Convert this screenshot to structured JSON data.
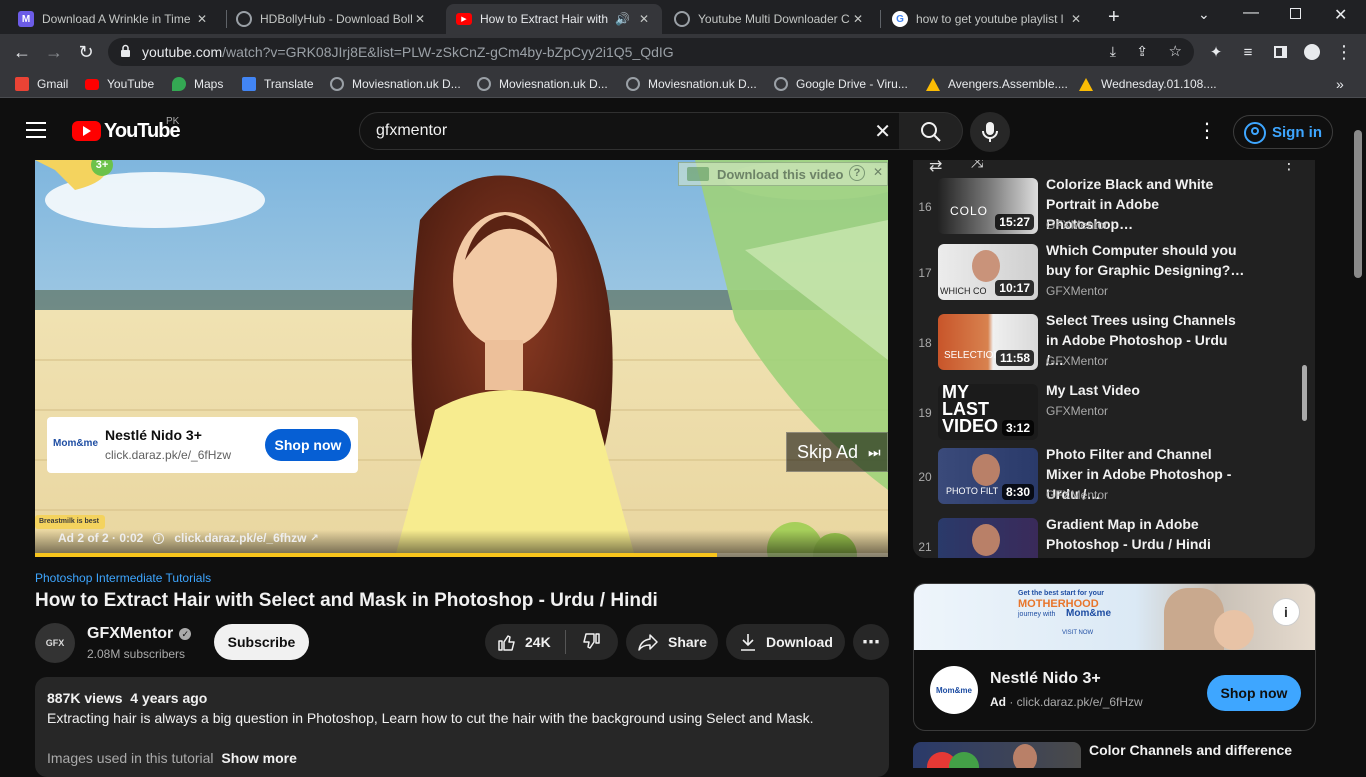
{
  "browser": {
    "tabs": [
      {
        "title": "Download A Wrinkle in Time",
        "icon": "m-favicon-icon",
        "color": "#6c5ce7"
      },
      {
        "title": "HDBollyHub - Download Boll",
        "icon": "globe-favicon-icon",
        "color": "#9aa0a6"
      },
      {
        "title": "How to Extract Hair with",
        "icon": "youtube-favicon-icon",
        "color": "#ff0000",
        "active": true
      },
      {
        "title": "Youtube Multi Downloader C",
        "icon": "globe-favicon-icon",
        "color": "#9aa0a6"
      },
      {
        "title": "how to get youtube playlist l",
        "icon": "google-favicon-icon",
        "color": "#4285f4"
      }
    ],
    "url_host": "youtube.com",
    "url_path": "/watch?v=GRK08JIrj8E&list=PLW-zSkCnZ-gCm4by-bZpCyy2i1Q5_QdIG",
    "bookmarks": [
      {
        "label": "Gmail",
        "color": "#ea4335"
      },
      {
        "label": "YouTube",
        "color": "#ff0000"
      },
      {
        "label": "Maps",
        "color": "#34a853"
      },
      {
        "label": "Translate",
        "color": "#4285f4"
      },
      {
        "label": "Moviesnation.uk D...",
        "color": "#9aa0a6"
      },
      {
        "label": "Moviesnation.uk D...",
        "color": "#9aa0a6"
      },
      {
        "label": "Moviesnation.uk D...",
        "color": "#9aa0a6"
      },
      {
        "label": "Google Drive - Viru...",
        "color": "#9aa0a6"
      },
      {
        "label": "Avengers.Assemble....",
        "color": "#fbbc04"
      },
      {
        "label": "Wednesday.01.108....",
        "color": "#fbbc04"
      }
    ]
  },
  "youtube": {
    "logo_text": "YouTube",
    "country": "PK",
    "search_value": "gfxmentor",
    "signin_label": "Sign in"
  },
  "ad": {
    "overlay_download": "Download this video",
    "brand_logo": "Mom&me",
    "title": "Nestlé Nido 3+",
    "url": "click.daraz.pk/e/_6fHzw",
    "shop_label": "Shop now",
    "skip_label": "Skip Ad",
    "age_badge": "3+",
    "breastmilk": "Breastmilk is best",
    "ad_info": "Ad 2 of 2 · 0:02",
    "ad_info_url": "click.daraz.pk/e/_6fhzw",
    "progress": 0.8
  },
  "video": {
    "playlist_link": "Photoshop Intermediate Tutorials",
    "title": "How to Extract Hair with Select and Mask in Photoshop - Urdu / Hindi",
    "channel": "GFXMentor",
    "channel_avatar_text": "GFX",
    "subscribers": "2.08M subscribers",
    "subscribe_label": "Subscribe",
    "likes": "24K",
    "share_label": "Share",
    "download_label": "Download",
    "views": "887K views",
    "age": "4 years ago",
    "description": "Extracting hair is always a big question in Photoshop, Learn how to cut the hair with the background using Select and Mask.",
    "desc_line2": "Images used in this tutorial",
    "show_more": "Show more"
  },
  "playlist": [
    {
      "num": "16",
      "title": "Colorize Black and White Portrait in Adobe Photoshop…",
      "channel": "GFXMentor",
      "duration": "15:27",
      "thumb_text": "COLO"
    },
    {
      "num": "17",
      "title": "Which Computer should you buy for Graphic Designing?…",
      "channel": "GFXMentor",
      "duration": "10:17",
      "thumb_text": "WHICH CO"
    },
    {
      "num": "18",
      "title": "Select Trees using Channels in Adobe Photoshop - Urdu /…",
      "channel": "GFXMentor",
      "duration": "11:58",
      "thumb_text": "SELECTION"
    },
    {
      "num": "19",
      "title": "My Last Video",
      "channel": "GFXMentor",
      "duration": "3:12",
      "thumb_text": "MY LAST VIDEO"
    },
    {
      "num": "20",
      "title": "Photo Filter and Channel Mixer in Adobe Photoshop - Urdu /…",
      "channel": "GFXMentor",
      "duration": "8:30",
      "thumb_text": "PHOTO FILT"
    },
    {
      "num": "21",
      "title": "Gradient Map in Adobe Photoshop - Urdu / Hindi",
      "channel": "",
      "duration": "",
      "thumb_text": ""
    }
  ],
  "side_ad": {
    "banner_line1": "Get the best start for your",
    "banner_line2": "MOTHERHOOD",
    "banner_line3": "journey with",
    "banner_cta": "VISIT NOW",
    "title": "Nestlé Nido 3+",
    "ad_label": "Ad",
    "url": "click.daraz.pk/e/_6fHzw",
    "shop_label": "Shop now",
    "logo_text": "Mom&me"
  },
  "next_video": {
    "title": "Color Channels and difference"
  }
}
